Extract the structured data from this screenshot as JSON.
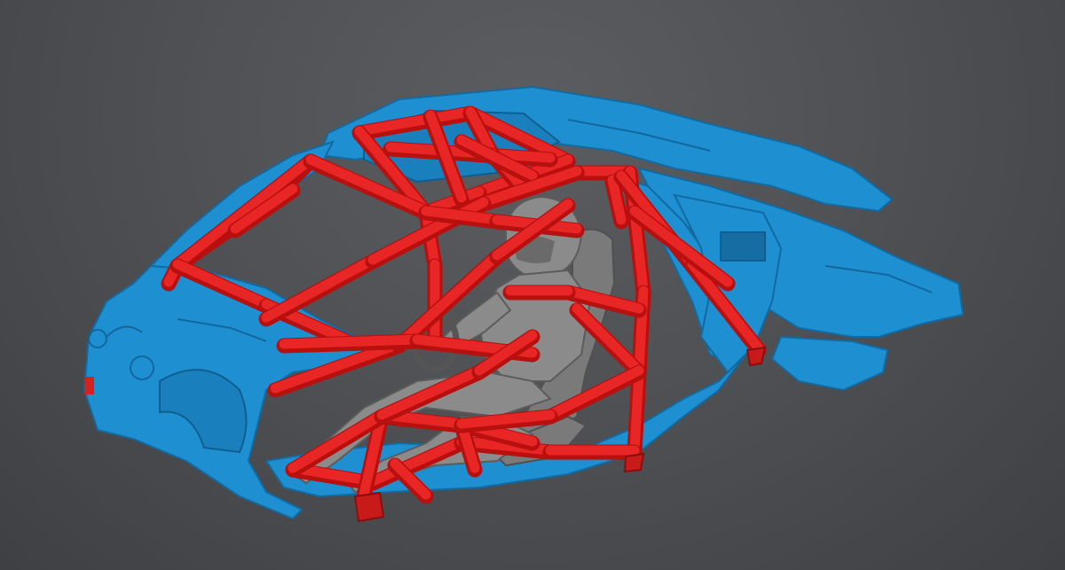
{
  "viewport": {
    "background_color": "#4f5155"
  },
  "model": {
    "body_shell_color": "#1e8fd1",
    "roll_cage_color": "#e82626",
    "driver_color": "#8b8b8b",
    "parts": [
      {
        "id": "body-shell",
        "icon": "car-body-shell"
      },
      {
        "id": "roll-cage",
        "icon": "roll-cage"
      },
      {
        "id": "driver-figure",
        "icon": "driver-helmet"
      },
      {
        "id": "racing-seat",
        "icon": "bucket-seat"
      }
    ]
  }
}
